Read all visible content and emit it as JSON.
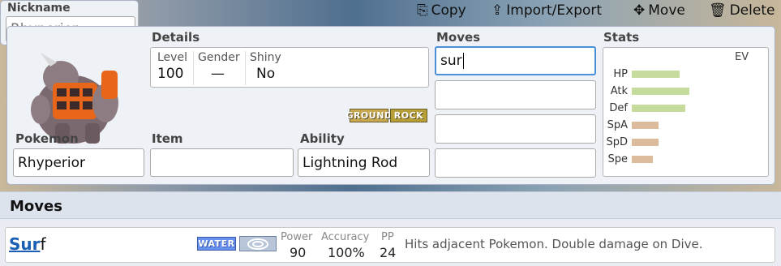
{
  "nickname": {
    "label": "Nickname",
    "placeholder": "Rhyperior"
  },
  "toolbar": {
    "copy": "Copy",
    "import_export": "Import/Export",
    "move": "Move",
    "delete": "Delete"
  },
  "details": {
    "label": "Details",
    "level_label": "Level",
    "level": "100",
    "gender_label": "Gender",
    "gender": "—",
    "shiny_label": "Shiny",
    "shiny": "No"
  },
  "types": [
    "GROUND",
    "ROCK"
  ],
  "pokemon": {
    "label": "Pokemon",
    "value": "Rhyperior"
  },
  "item": {
    "label": "Item",
    "value": ""
  },
  "ability": {
    "label": "Ability",
    "value": "Lightning Rod"
  },
  "moves": {
    "label": "Moves",
    "slots": [
      "sur",
      "",
      "",
      ""
    ]
  },
  "stats": {
    "label": "Stats",
    "ev_label": "EV",
    "rows": [
      {
        "name": "HP",
        "fraction": 0.47,
        "color": "#c6dc9c"
      },
      {
        "name": "Atk",
        "fraction": 0.57,
        "color": "#c6dc9c"
      },
      {
        "name": "Def",
        "fraction": 0.53,
        "color": "#c6dc9c"
      },
      {
        "name": "SpA",
        "fraction": 0.26,
        "color": "#dcbc9c"
      },
      {
        "name": "SpD",
        "fraction": 0.26,
        "color": "#dcbc9c"
      },
      {
        "name": "Spe",
        "fraction": 0.21,
        "color": "#dcbc9c"
      }
    ]
  },
  "moves_section": {
    "title": "Moves"
  },
  "move_result": {
    "name_match": "Sur",
    "name_rest": "f",
    "type": "WATER",
    "category_icon": "special-category-icon",
    "power_label": "Power",
    "power": "90",
    "accuracy_label": "Accuracy",
    "accuracy": "100%",
    "pp_label": "PP",
    "pp": "24",
    "description": "Hits adjacent Pokemon. Double damage on Dive."
  },
  "colors": {
    "ground": "#c8a850",
    "rock": "#b8a038",
    "water": "#6890f0",
    "link": "#1a5fb4"
  }
}
